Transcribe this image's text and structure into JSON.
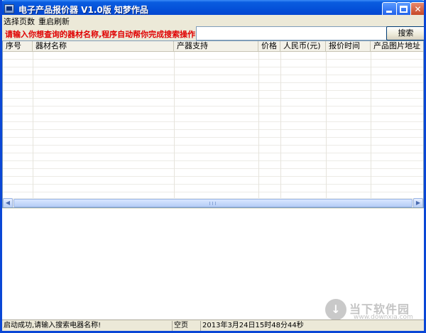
{
  "window": {
    "title": "电子产品报价器 V1.0版 知梦作品",
    "min_label": "",
    "max_label": "",
    "close_label": "✕"
  },
  "menu": {
    "items": [
      {
        "label": "选择页数"
      },
      {
        "label": "重启刷新"
      }
    ]
  },
  "search": {
    "prompt": "请输入你想查询的器材名称,程序自动帮你完成搜索操作!",
    "value": "",
    "button_label": "搜索"
  },
  "grid": {
    "columns": [
      {
        "label": "序号"
      },
      {
        "label": "器材名称"
      },
      {
        "label": "产器支持"
      },
      {
        "label": "价格"
      },
      {
        "label": "人民币(元)"
      },
      {
        "label": "报价时间"
      },
      {
        "label": "产品图片地址"
      }
    ],
    "rows": []
  },
  "scrollbar": {
    "left_arrow": "◀",
    "right_arrow": "▶"
  },
  "watermark": {
    "symbol": "↓",
    "brand": "当下软件园",
    "url": "www.downxia.com"
  },
  "status": {
    "message": "启动成功,请输入搜索电器名称!",
    "page": "空页",
    "datetime": "2013年3月24日15时48分44秒"
  }
}
